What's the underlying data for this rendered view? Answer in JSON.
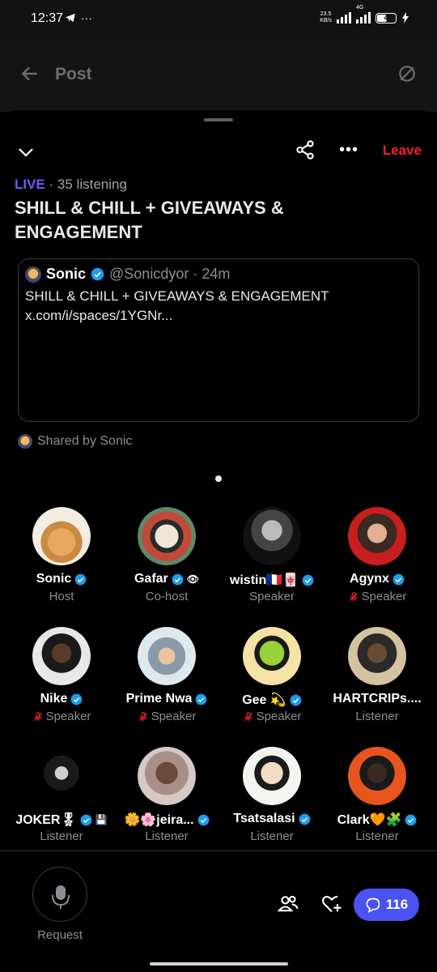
{
  "status_bar": {
    "time": "12:37",
    "left_icons": [
      "telegram-icon",
      "more-dots-icon"
    ],
    "net_speed_value": "23.5",
    "net_speed_unit": "KB/s",
    "network": "4G",
    "battery": "4"
  },
  "post_header": {
    "title": "Post"
  },
  "space": {
    "leave_label": "Leave",
    "live_label": "LIVE",
    "listening": "· 35 listening",
    "title": "SHILL & CHILL + GIVEAWAYS & ENGAGEMENT"
  },
  "tweet": {
    "name": "Sonic",
    "handle": "@Sonicdyor · 24m",
    "body": "SHILL & CHILL + GIVEAWAYS & ENGAGEMENT  x.com/i/spaces/1YGNr..."
  },
  "shared_by": "Shared by Sonic",
  "participants": [
    {
      "name": "Sonic",
      "role": "Host",
      "muted": false,
      "verified": true,
      "extra": ""
    },
    {
      "name": "Gafar",
      "role": "Co-host",
      "muted": false,
      "verified": true,
      "extra": "👁"
    },
    {
      "name": "wistin🇫🇷🀄",
      "role": "Speaker",
      "muted": false,
      "verified": true,
      "extra": ""
    },
    {
      "name": "Agynx",
      "role": "Speaker",
      "muted": true,
      "verified": true,
      "extra": ""
    },
    {
      "name": "Nike",
      "role": "Speaker",
      "muted": true,
      "verified": true,
      "extra": ""
    },
    {
      "name": "Prime Nwa",
      "role": "Speaker",
      "muted": true,
      "verified": true,
      "extra": ""
    },
    {
      "name": "Gee 💫",
      "role": "Speaker",
      "muted": true,
      "verified": true,
      "extra": ""
    },
    {
      "name": "HARTCRIPs....",
      "role": "Listener",
      "muted": false,
      "verified": false,
      "extra": ""
    },
    {
      "name": "JOKER🎖",
      "role": "Listener",
      "muted": false,
      "verified": true,
      "extra": "💾"
    },
    {
      "name": "🌼🌸jeira...",
      "role": "Listener",
      "muted": false,
      "verified": true,
      "extra": ""
    },
    {
      "name": "Tsatsalasi",
      "role": "Listener",
      "muted": false,
      "verified": true,
      "extra": ""
    },
    {
      "name": "Clark🧡🧩",
      "role": "Listener",
      "muted": false,
      "verified": true,
      "extra": ""
    }
  ],
  "bottom_bar": {
    "request_label": "Request",
    "chat_count": "116"
  },
  "colors": {
    "live": "#7856ff",
    "leave": "#f4212e",
    "verified": "#1d9bf0",
    "muted": "#f4212e",
    "chat_pill": "#4b52f2"
  }
}
